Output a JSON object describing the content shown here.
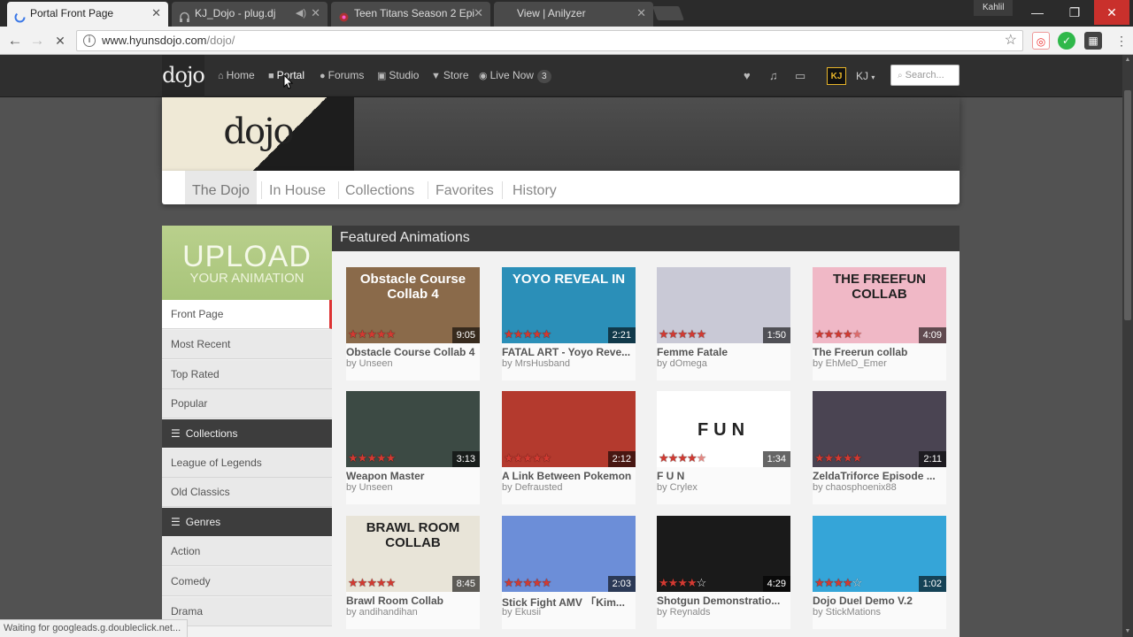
{
  "browser": {
    "tabs": [
      {
        "title": "Portal Front Page",
        "active": true
      },
      {
        "title": "KJ_Dojo - plug.dj",
        "active": false
      },
      {
        "title": "Teen Titans Season 2 Epi",
        "active": false
      },
      {
        "title": "View | Anilyzer",
        "active": false
      }
    ],
    "profile_name": "Kahlil",
    "url_host": "www.hyunsdojo.com",
    "url_path": "/dojo/",
    "status_text": "Waiting for googleads.g.doubleclick.net..."
  },
  "site": {
    "logo": "dojo",
    "nav": [
      {
        "label": "Home",
        "icon": "home-icon"
      },
      {
        "label": "Portal",
        "icon": "video-camera-icon"
      },
      {
        "label": "Forums",
        "icon": "comments-icon"
      },
      {
        "label": "Studio",
        "icon": "film-icon"
      },
      {
        "label": "Store",
        "icon": "cart-icon"
      },
      {
        "label": "Live Now",
        "icon": "eye-icon",
        "count": "3"
      }
    ],
    "avatar_text": "KJ",
    "username": "KJ",
    "search_placeholder": "Search..."
  },
  "banner_logo": "dojo",
  "page_tabs": [
    "The Dojo",
    "In House",
    "Collections",
    "Favorites",
    "History"
  ],
  "upload": {
    "big": "UPLOAD",
    "small": "YOUR ANIMATION"
  },
  "sidebar": {
    "group1": [
      "Front Page",
      "Most Recent",
      "Top Rated",
      "Popular"
    ],
    "collections_header": "Collections",
    "collections": [
      "League of Legends",
      "Old Classics"
    ],
    "genres_header": "Genres",
    "genres": [
      "Action",
      "Comedy",
      "Drama"
    ]
  },
  "featured_header": "Featured Animations",
  "videos": [
    {
      "title": "Obstacle Course Collab 4",
      "author": "by Unseen",
      "duration": "9:05",
      "rating": 5,
      "thumb_text": "Obstacle Course Collab 4",
      "bg": "#8a6a4a"
    },
    {
      "title": "FATAL ART - Yoyo Reve...",
      "author": "by MrsHusband",
      "duration": "2:21",
      "rating": 5,
      "thumb_text": "YOYO REVEAL IN",
      "bg": "#2b8fb8"
    },
    {
      "title": "Femme Fatale",
      "author": "by dOmega",
      "duration": "1:50",
      "rating": 5,
      "thumb_text": "",
      "bg": "#c9c9d6"
    },
    {
      "title": "The Freerun collab",
      "author": "by EhMeD_Emer",
      "duration": "4:09",
      "rating": 4.5,
      "thumb_text": "THE FREEFUN COLLAB",
      "bg": "#f0b8c6"
    },
    {
      "title": "Weapon Master",
      "author": "by Unseen",
      "duration": "3:13",
      "rating": 5,
      "thumb_text": "",
      "bg": "#3c4a44"
    },
    {
      "title": "A Link Between Pokemon",
      "author": "by Defrausted",
      "duration": "2:12",
      "rating": 5,
      "thumb_text": "",
      "bg": "#b43a2e"
    },
    {
      "title": "F U N",
      "author": "by Crylex",
      "duration": "1:34",
      "rating": 4.5,
      "thumb_text": "FUN",
      "bg": "#ffffff"
    },
    {
      "title": "ZeldaTriforce Episode ...",
      "author": "by chaosphoenix88",
      "duration": "2:11",
      "rating": 5,
      "thumb_text": "",
      "bg": "#4a4452"
    },
    {
      "title": "Brawl Room Collab",
      "author": "by andihandihan",
      "duration": "8:45",
      "rating": 5,
      "thumb_text": "BRAWL ROOM COLLAB",
      "bg": "#e8e4d8"
    },
    {
      "title": "Stick Fight AMV 「Kim...",
      "author": "by Ekusii",
      "duration": "2:03",
      "rating": 5,
      "thumb_text": "",
      "bg": "#6c8ed8"
    },
    {
      "title": "Shotgun Demonstratio...",
      "author": "by Reynalds",
      "duration": "4:29",
      "rating": 4,
      "thumb_text": "",
      "bg": "#1a1a1a"
    },
    {
      "title": "Dojo Duel Demo V.2",
      "author": "by StickMations",
      "duration": "1:02",
      "rating": 4,
      "thumb_text": "",
      "bg": "#35a5d8"
    }
  ],
  "colors": {
    "accent_red": "#d23a32",
    "upload_green": "#b0ca84",
    "topbar": "#2f2f2f"
  }
}
